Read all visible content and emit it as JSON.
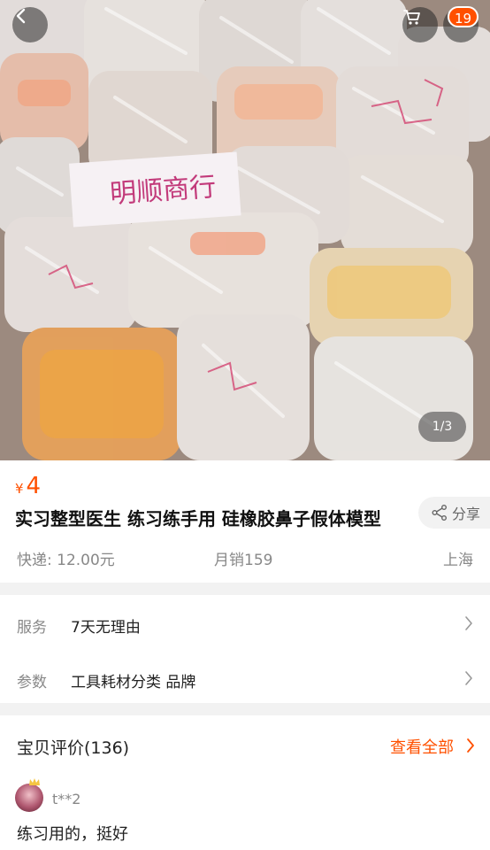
{
  "header": {
    "cart_badge": "19",
    "image_pager": "1/3"
  },
  "product_image": {
    "sign_text": "明顺商行"
  },
  "product": {
    "currency": "¥",
    "price": "4",
    "title": "实习整型医生 练习练手用 硅橡胶鼻子假体模型",
    "share_label": "分享",
    "shipping": "快递: 12.00元",
    "monthly_sales": "月销159",
    "location": "上海"
  },
  "params": {
    "rows": [
      {
        "key": "服务",
        "value": "7天无理由"
      },
      {
        "key": "参数",
        "value": "工具耗材分类 品牌"
      }
    ]
  },
  "reviews": {
    "title": "宝贝评价(136)",
    "view_all": "查看全部",
    "items": [
      {
        "user": "t**2",
        "text": "练习用的，挺好"
      }
    ]
  },
  "colors": {
    "accent": "#ff5000",
    "muted": "#888888",
    "page_bg": "#f2f2f2"
  },
  "icons": [
    "back-icon",
    "cart-icon",
    "more-icon",
    "share-icon",
    "chevron-right-icon"
  ]
}
